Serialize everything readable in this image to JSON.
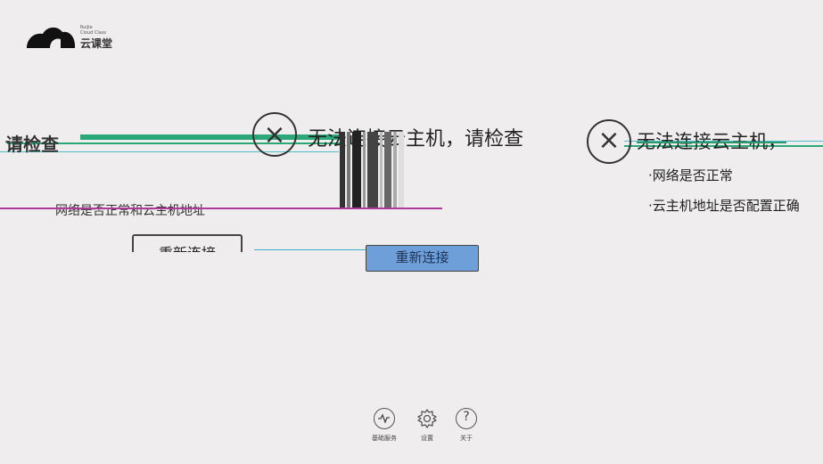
{
  "logo": {
    "en_line1": "Ruijie",
    "en_line2": "Cloud Class",
    "cn_name": "云课堂"
  },
  "message": {
    "left_text": "无法连接云主机，请检查",
    "left_icon": "×",
    "right_text": "无法连接云主机，",
    "right_icon": "×",
    "check_title": "请检查",
    "bullets": [
      "·网络是否正常",
      "·云主机地址是否配置正确"
    ],
    "hint": "网络是否正常和云主机地址"
  },
  "buttons": {
    "reconnect_left": "重新连接",
    "reconnect_right": "重新连接"
  },
  "toolbar": {
    "items": [
      {
        "label": "基础服务",
        "icon": "pulse-icon"
      },
      {
        "label": "设置",
        "icon": "gear-icon"
      },
      {
        "label": "关于",
        "icon": "question-icon"
      }
    ]
  },
  "colors": {
    "background": "#efeded",
    "primary_button": "#6f9fd8",
    "glitch_green": "#2aa878",
    "glitch_pink": "#b3389a"
  }
}
